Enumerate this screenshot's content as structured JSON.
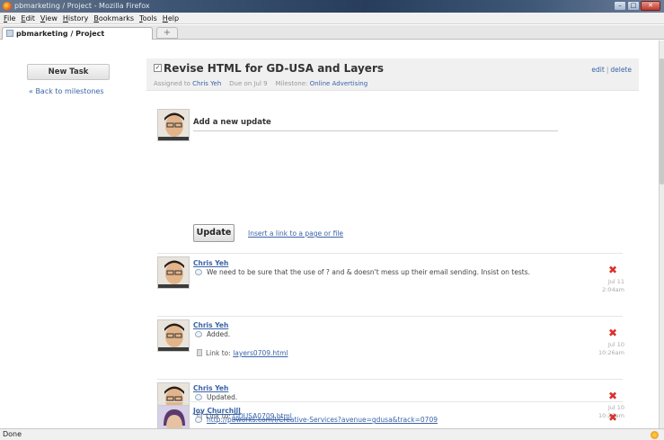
{
  "window": {
    "title": "pbmarketing / Project - Mozilla Firefox",
    "controls": [
      "–",
      "□",
      "✕"
    ]
  },
  "menu": [
    "File",
    "Edit",
    "View",
    "History",
    "Bookmarks",
    "Tools",
    "Help"
  ],
  "tabs": [
    {
      "label": "pbmarketing / Project"
    }
  ],
  "new_tab_label": "+",
  "sidebar": {
    "new_task_label": "New Task",
    "back_label": "« Back to milestones"
  },
  "task": {
    "title": "Revise HTML for GD-USA and Layers",
    "assigned_prefix": "Assigned to",
    "assignee": "Chris Yeh",
    "due_label": "Due on Jul 9",
    "milestone_prefix": "Milestone:",
    "milestone": "Online Advertising",
    "edit_label": "edit",
    "delete_label": "delete"
  },
  "composer": {
    "title": "Add a new update",
    "button_label": "Update",
    "insert_link_label": "Insert a link to a page or file"
  },
  "updates": [
    {
      "author": "Chris Yeh",
      "text": "We need to be sure that the use of ? and & doesn't mess up their email sending. Insist on tests.",
      "date": "Jul 11",
      "time": "2:04am"
    },
    {
      "author": "Chris Yeh",
      "text": "Added.",
      "link_prefix": "Link to:",
      "link": "layers0709.html",
      "date": "Jul 10",
      "time": "10:26am"
    },
    {
      "author": "Chris Yeh",
      "text": "Updated.",
      "link_prefix": "Link to:",
      "link": "GDUSA0709.html",
      "date": "Jul 10",
      "time": "10:26am"
    },
    {
      "author": "Joy Churchill",
      "url": "http://pbworks.com/i/Creative-Services?avenue=gdusa&track=0709"
    }
  ],
  "delete_glyph": "✖",
  "status": {
    "text": "Done"
  },
  "colors": {
    "link": "#3a63a8",
    "delete": "#d9322b",
    "header_bg": "#f0f0f0"
  }
}
